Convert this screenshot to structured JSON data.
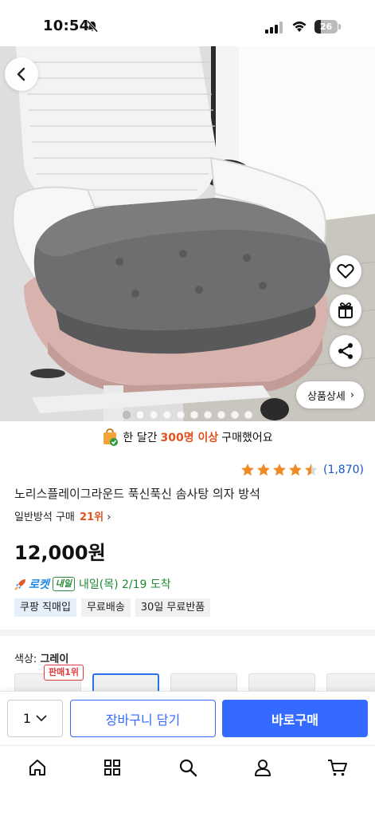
{
  "status_bar": {
    "time": "10:54",
    "battery": "26",
    "battery_level": 0.26
  },
  "hero": {
    "back_icon": "chevron-left-icon",
    "side_actions": [
      "heart-icon",
      "gift-icon",
      "share-icon"
    ],
    "detail_button_label": "상품상세",
    "image_count": 10,
    "current_image": 1
  },
  "purchase_notice": {
    "prefix": "한 달간",
    "count": "300명 이상",
    "suffix": "구매했어요"
  },
  "rating": {
    "stars": 4.5,
    "count": "(1,870)"
  },
  "product": {
    "title": "노리스플레이그라운드 푹신푹신 솜사탕 의자 방석",
    "rank_label": "일반방석 구매",
    "rank_value": "21위",
    "price": "12,000원"
  },
  "delivery": {
    "logo": "로켓",
    "badge": "내일",
    "date": "내일(목) 2/19 도착"
  },
  "tags": [
    "쿠팡 직매입",
    "무료배송",
    "30일 무료반품"
  ],
  "options": {
    "label": "색상:",
    "selected": "그레이",
    "best_badge": "판매1위"
  },
  "action_bar": {
    "quantity": "1",
    "cart_label": "장바구니 담기",
    "buy_label": "바로구매"
  },
  "tabbar": {
    "items": [
      "home-icon",
      "category-icon",
      "search-icon",
      "my-page-icon",
      "cart-icon"
    ]
  },
  "colors": {
    "accent": "#346aff",
    "orange": "#e0531f",
    "star": "#f08a24"
  }
}
